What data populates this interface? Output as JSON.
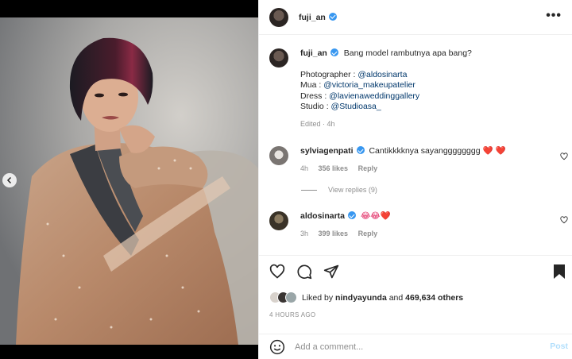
{
  "post": {
    "author": "fuji_an",
    "more_label": "•••"
  },
  "caption": {
    "author": "fuji_an",
    "text": "Bang model rambutnya apa bang?",
    "credits": [
      {
        "label": "Photographer : ",
        "handle": "@aldosinarta"
      },
      {
        "label": "Mua : ",
        "handle": "@victoria_makeupatelier"
      },
      {
        "label": "Dress : ",
        "handle": "@lavienaweddinggallery"
      },
      {
        "label": "Studio : ",
        "handle": "@Studioasa_"
      }
    ],
    "edited": "Edited · 4h"
  },
  "comments": [
    {
      "author": "sylviagenpati",
      "text": "Cantikkkknya sayangggggggg",
      "emoji": "❤️ ❤️",
      "time": "4h",
      "likes": "356 likes",
      "reply": "Reply",
      "view_replies": "View replies (9)"
    },
    {
      "author": "aldosinarta",
      "text": "",
      "emoji": "😂😂❤️",
      "time": "3h",
      "likes": "399 likes",
      "reply": "Reply"
    }
  ],
  "likes": {
    "prefix": "Liked by ",
    "user": "nindyayunda",
    "middle": " and ",
    "count": "469,634 others"
  },
  "timestamp": "4 HOURS AGO",
  "add_comment": {
    "placeholder": "Add a comment...",
    "post_label": "Post"
  },
  "colors": {
    "verified": "#3897f0",
    "link": "#00376b",
    "muted": "#8e8e8e",
    "post_disabled": "#b2dffc"
  },
  "icons": [
    "chevron-left-icon",
    "more-icon",
    "heart-icon",
    "comment-icon",
    "share-icon",
    "bookmark-icon",
    "emoji-icon",
    "verified-icon"
  ]
}
